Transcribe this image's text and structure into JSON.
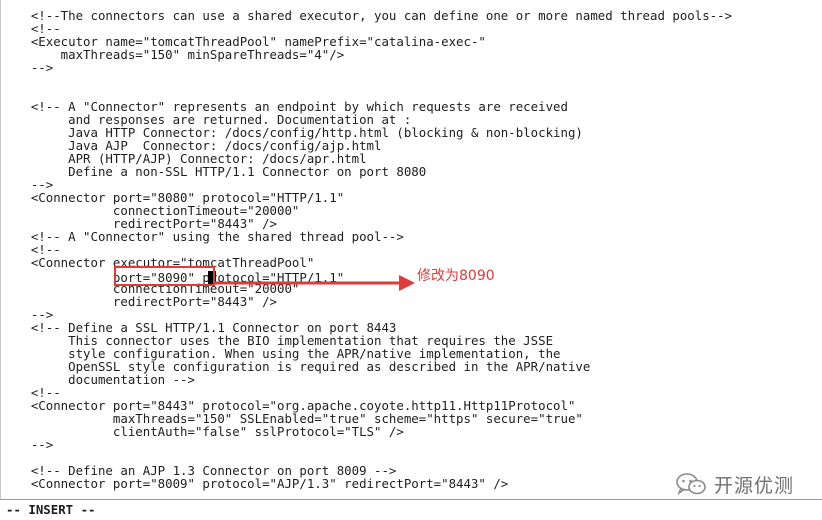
{
  "editor": {
    "lines": [
      "    <!--The connectors can use a shared executor, you can define one or more named thread pools-->",
      "    <!--",
      "    <Executor name=\"tomcatThreadPool\" namePrefix=\"catalina-exec-\"",
      "        maxThreads=\"150\" minSpareThreads=\"4\"/>",
      "    -->",
      "",
      "",
      "    <!-- A \"Connector\" represents an endpoint by which requests are received",
      "         and responses are returned. Documentation at :",
      "         Java HTTP Connector: /docs/config/http.html (blocking & non-blocking)",
      "         Java AJP  Connector: /docs/config/ajp.html",
      "         APR (HTTP/AJP) Connector: /docs/apr.html",
      "         Define a non-SSL HTTP/1.1 Connector on port 8080",
      "    -->",
      "    <Connector port=\"8080\" protocol=\"HTTP/1.1\"",
      "               connectionTimeout=\"20000\"",
      "               redirectPort=\"8443\" />",
      "    <!-- A \"Connector\" using the shared thread pool-->",
      "    <!--",
      "    <Connector executor=\"tomcatThreadPool\"",
      "               port=\"8090\" protocol=\"HTTP/1.1\"",
      "               connectionTimeout=\"20000\"",
      "               redirectPort=\"8443\" />",
      "    -->",
      "    <!-- Define a SSL HTTP/1.1 Connector on port 8443",
      "         This connector uses the BIO implementation that requires the JSSE",
      "         style configuration. When using the APR/native implementation, the",
      "         OpenSSL style configuration is required as described in the APR/native",
      "         documentation -->",
      "    <!--",
      "    <Connector port=\"8443\" protocol=\"org.apache.coyote.http11.Http11Protocol\"",
      "               maxThreads=\"150\" SSLEnabled=\"true\" scheme=\"https\" secure=\"true\"",
      "               clientAuth=\"false\" sslProtocol=\"TLS\" />",
      "    -->",
      "",
      "    <!-- Define an AJP 1.3 Connector on port 8009 -->",
      "    <Connector port=\"8009\" protocol=\"AJP/1.3\" redirectPort=\"8443\" />"
    ]
  },
  "annotation": {
    "label": "修改为8090",
    "color": "#e03a3a"
  },
  "status_bar": {
    "mode": "-- INSERT --"
  },
  "watermark": {
    "text": "开源优测",
    "icon": "wechat-icon"
  }
}
